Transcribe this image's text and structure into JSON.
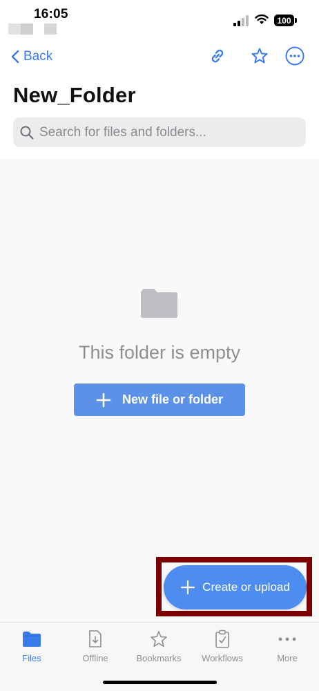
{
  "status_bar": {
    "time": "16:05",
    "battery": "100"
  },
  "nav": {
    "back_label": "Back",
    "icons": [
      "link-icon",
      "star-icon",
      "more-icon"
    ]
  },
  "page": {
    "title": "New_Folder"
  },
  "search": {
    "placeholder": "Search for files and folders..."
  },
  "empty_state": {
    "message": "This folder is empty",
    "button_label": "New file or folder"
  },
  "fab": {
    "label": "Create or upload"
  },
  "tabs": [
    {
      "label": "Files",
      "icon": "folder-icon",
      "active": true
    },
    {
      "label": "Offline",
      "icon": "offline-icon",
      "active": false
    },
    {
      "label": "Bookmarks",
      "icon": "star-icon",
      "active": false
    },
    {
      "label": "Workflows",
      "icon": "clipboard-check-icon",
      "active": false
    },
    {
      "label": "More",
      "icon": "more-icon",
      "active": false
    }
  ],
  "colors": {
    "accent": "#3a7bec",
    "button": "#5b91e6",
    "fab": "#4d8cf0",
    "highlight": "#7d0000"
  }
}
